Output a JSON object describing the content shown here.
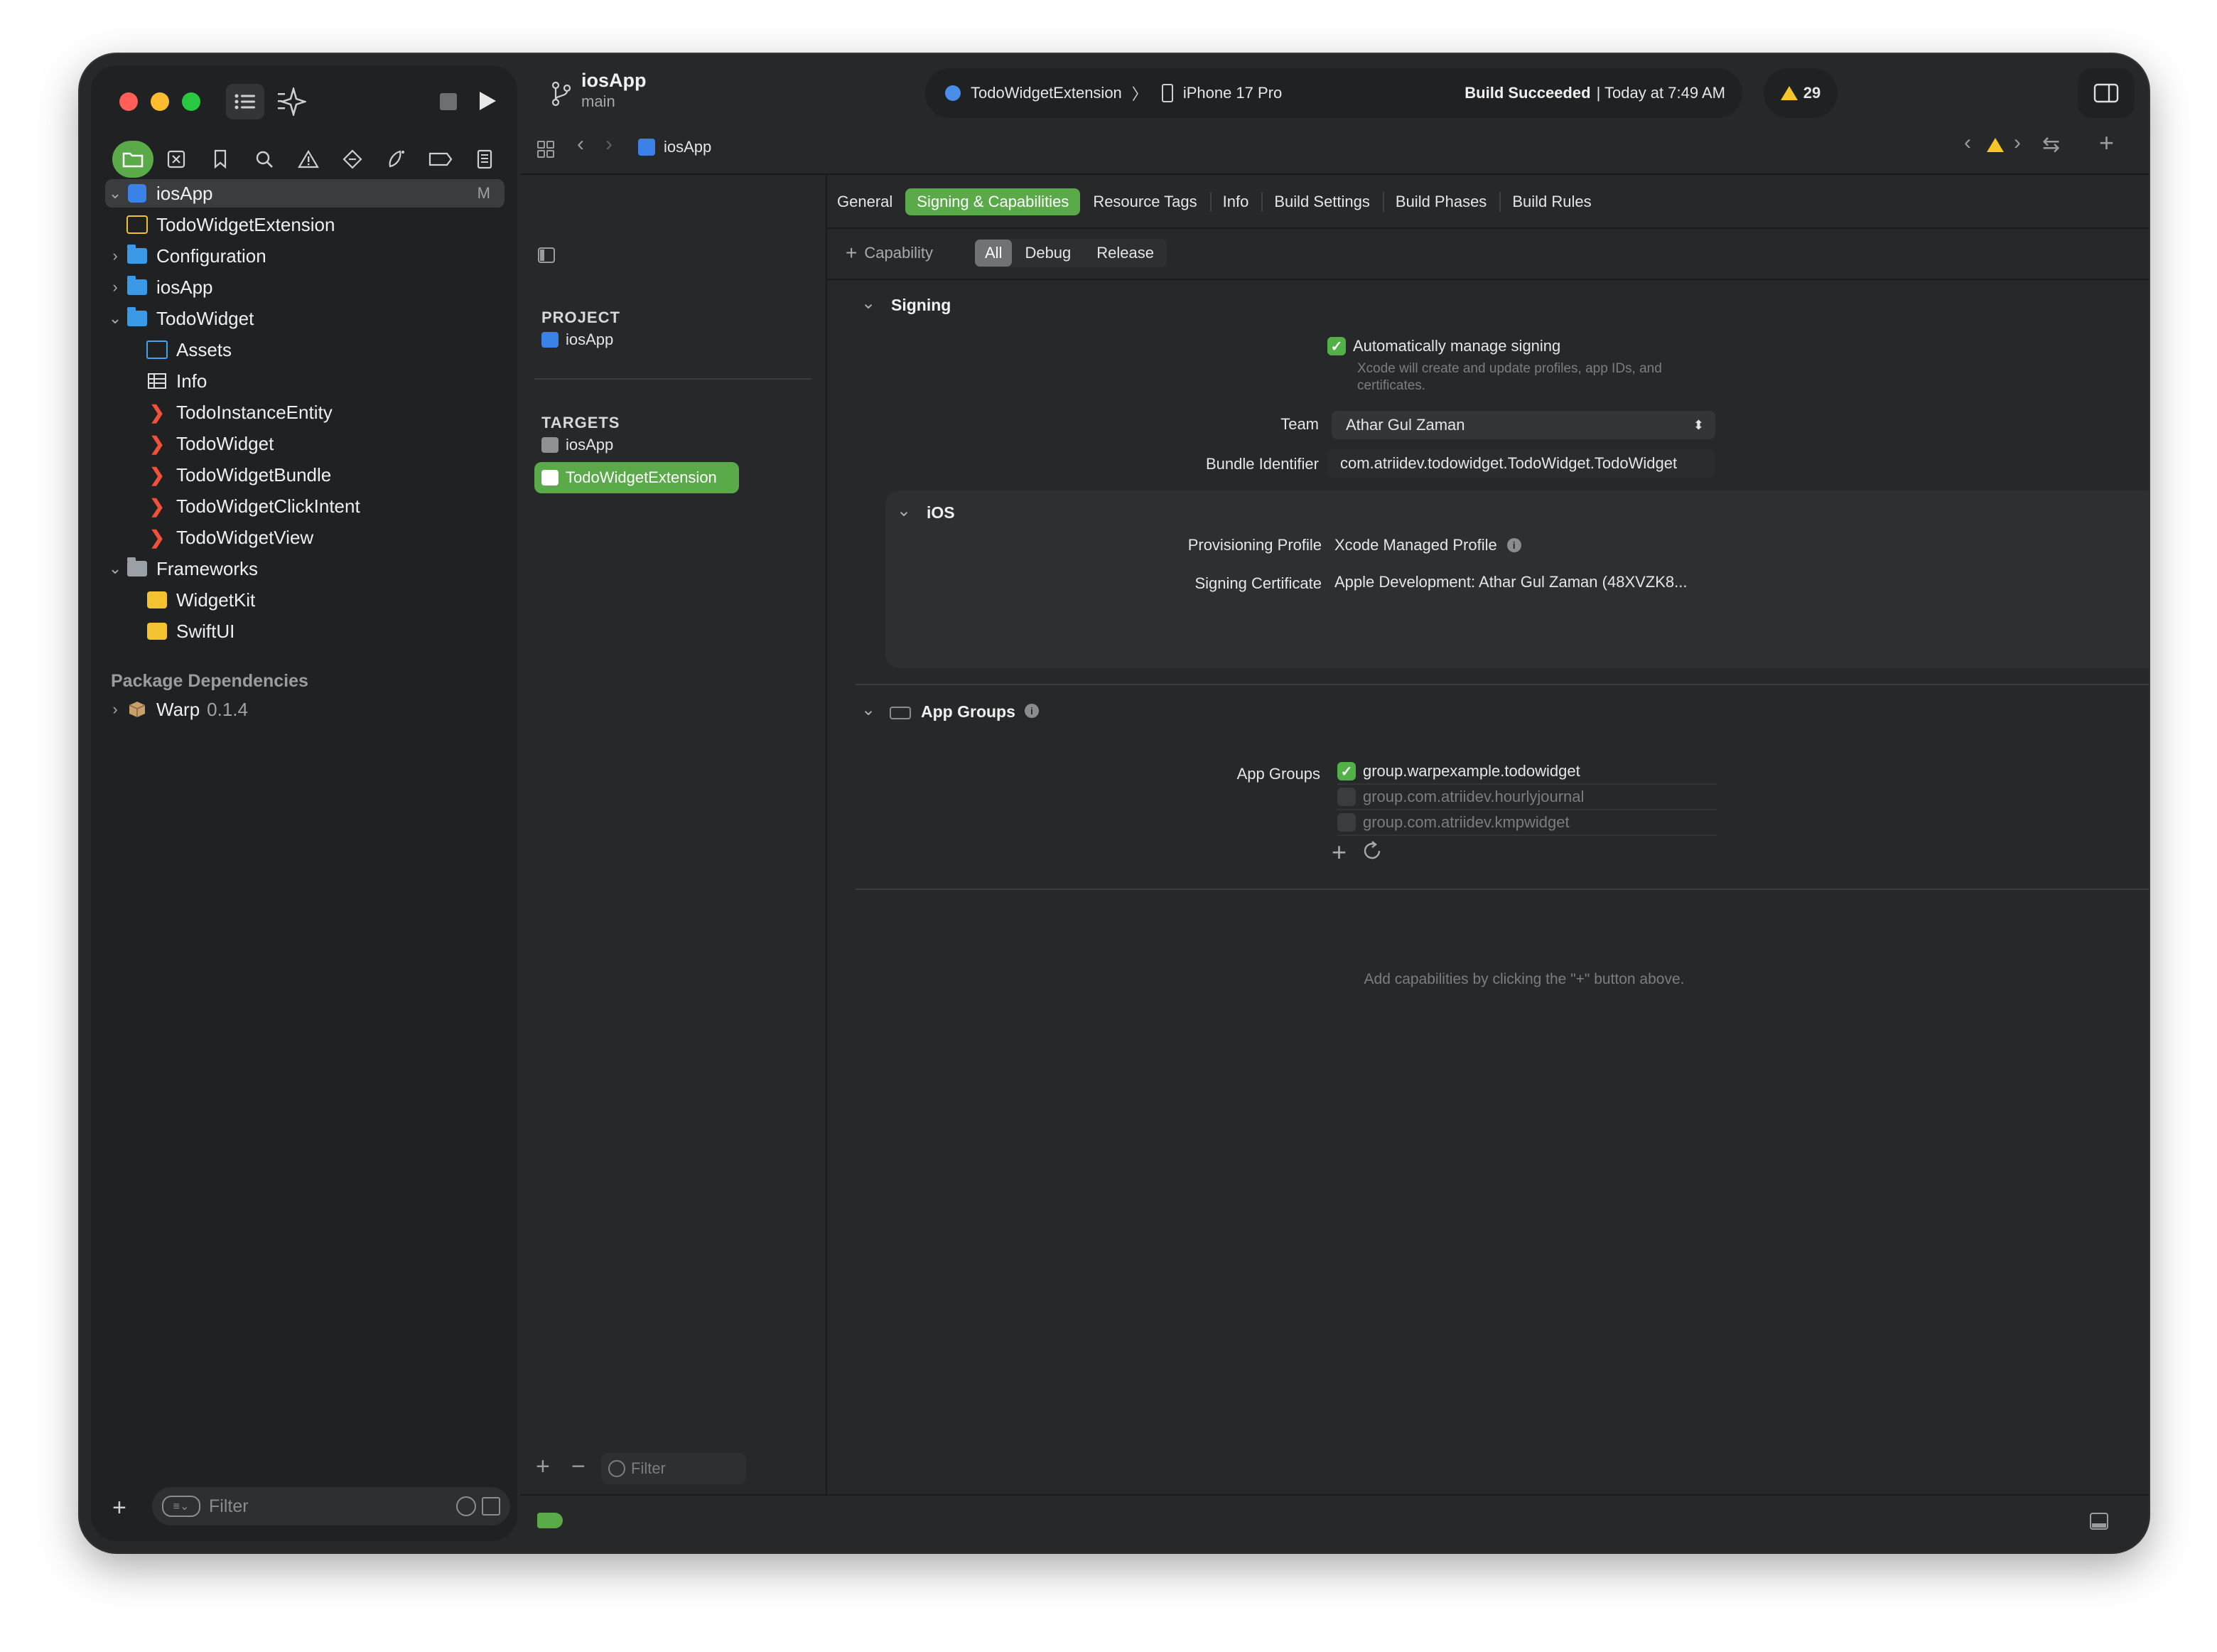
{
  "toolbar": {
    "project_name": "iosApp",
    "branch": "main",
    "scheme": "TodoWidgetExtension",
    "destination": "iPhone 17 Pro",
    "build_status_bold": "Build Succeeded",
    "build_status_rest": "| Today at 7:49 AM",
    "warning_count": "29"
  },
  "navigator": {
    "root": {
      "label": "iosApp",
      "badge": "M"
    },
    "items": [
      {
        "label": "TodoWidgetExtension"
      },
      {
        "label": "Configuration"
      },
      {
        "label": "iosApp"
      },
      {
        "label": "TodoWidget"
      },
      {
        "label": "Assets"
      },
      {
        "label": "Info"
      },
      {
        "label": "TodoInstanceEntity"
      },
      {
        "label": "TodoWidget"
      },
      {
        "label": "TodoWidgetBundle"
      },
      {
        "label": "TodoWidgetClickIntent"
      },
      {
        "label": "TodoWidgetView"
      },
      {
        "label": "Frameworks"
      },
      {
        "label": "WidgetKit"
      },
      {
        "label": "SwiftUI"
      }
    ],
    "package_header": "Package Dependencies",
    "package": {
      "name": "Warp",
      "version": "0.1.4"
    },
    "filter_placeholder": "Filter"
  },
  "jumpbar": {
    "item": "iosApp"
  },
  "targets_pane": {
    "project_header": "PROJECT",
    "project_item": "iosApp",
    "targets_header": "TARGETS",
    "targets": [
      "iosApp",
      "TodoWidgetExtension"
    ],
    "filter_placeholder": "Filter"
  },
  "editor_tabs": [
    "General",
    "Signing & Capabilities",
    "Resource Tags",
    "Info",
    "Build Settings",
    "Build Phases",
    "Build Rules"
  ],
  "capability_bar": {
    "add_label": "Capability",
    "filters": [
      "All",
      "Debug",
      "Release"
    ]
  },
  "signing": {
    "title": "Signing",
    "auto_manage": "Automatically manage signing",
    "auto_desc_line1": "Xcode will create and update profiles, app IDs, and",
    "auto_desc_line2": "certificates.",
    "team_label": "Team",
    "team_value": "Athar Gul Zaman",
    "bundle_label": "Bundle Identifier",
    "bundle_value": "com.atriidev.todowidget.TodoWidget.TodoWidget",
    "ios_title": "iOS",
    "profile_label": "Provisioning Profile",
    "profile_value": "Xcode Managed Profile",
    "cert_label": "Signing Certificate",
    "cert_value": "Apple Development: Athar Gul Zaman (48XVZK8..."
  },
  "app_groups": {
    "title": "App Groups",
    "label": "App Groups",
    "groups": [
      {
        "name": "group.warpexample.todowidget",
        "checked": true
      },
      {
        "name": "group.com.atriidev.hourlyjournal",
        "checked": false
      },
      {
        "name": "group.com.atriidev.kmpwidget",
        "checked": false
      }
    ]
  },
  "hint": "Add capabilities by clicking the \"+\" button above.",
  "colors": {
    "accent": "#5aaa4a",
    "folder": "#3b9ae8",
    "warning": "#f5c62a",
    "swift": "#f05138"
  }
}
